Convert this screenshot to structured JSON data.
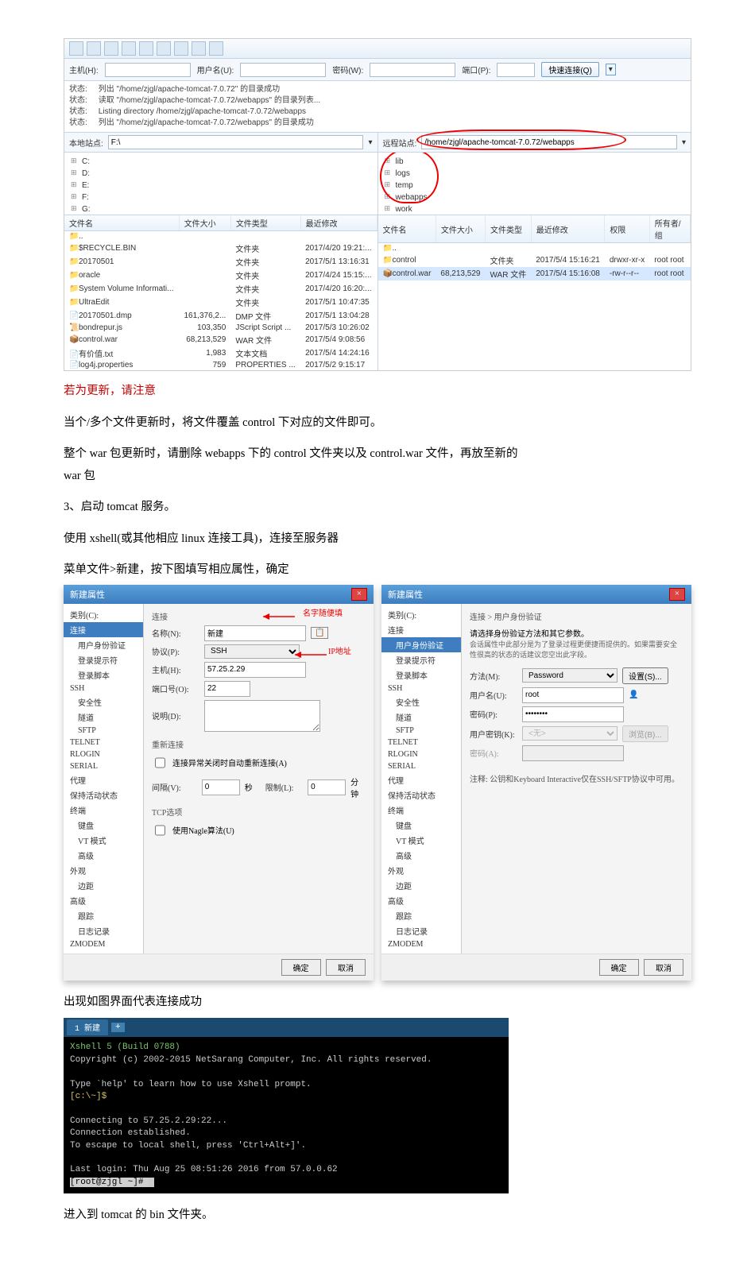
{
  "ftp": {
    "conn": {
      "host_label": "主机(H):",
      "user_label": "用户名(U):",
      "pass_label": "密码(W):",
      "port_label": "端口(P):",
      "connect_btn": "快速连接(Q)"
    },
    "status": [
      {
        "label": "状态:",
        "msg": "列出 \"/home/zjgl/apache-tomcat-7.0.72\" 的目录成功"
      },
      {
        "label": "状态:",
        "msg": "读取 \"/home/zjgl/apache-tomcat-7.0.72/webapps\" 的目录列表..."
      },
      {
        "label": "状态:",
        "msg": "Listing directory /home/zjgl/apache-tomcat-7.0.72/webapps"
      },
      {
        "label": "状态:",
        "msg": "列出 \"/home/zjgl/apache-tomcat-7.0.72/webapps\" 的目录成功"
      }
    ],
    "local": {
      "path_label": "本地站点:",
      "path": "F:\\",
      "tree": [
        "C:",
        "D:",
        "E:",
        "F:",
        "G:"
      ],
      "cols": [
        "文件名",
        "文件大小",
        "文件类型",
        "最近修改"
      ],
      "rows": [
        {
          "ic": "📁",
          "name": "..",
          "size": "",
          "type": "",
          "mtime": ""
        },
        {
          "ic": "📁",
          "name": "$RECYCLE.BIN",
          "size": "",
          "type": "文件夹",
          "mtime": "2017/4/20 19:21:..."
        },
        {
          "ic": "📁",
          "name": "20170501",
          "size": "",
          "type": "文件夹",
          "mtime": "2017/5/1 13:16:31"
        },
        {
          "ic": "📁",
          "name": "oracle",
          "size": "",
          "type": "文件夹",
          "mtime": "2017/4/24 15:15:..."
        },
        {
          "ic": "📁",
          "name": "System Volume Informati...",
          "size": "",
          "type": "文件夹",
          "mtime": "2017/4/20 16:20:..."
        },
        {
          "ic": "📁",
          "name": "UltraEdit",
          "size": "",
          "type": "文件夹",
          "mtime": "2017/5/1 10:47:35"
        },
        {
          "ic": "📄",
          "name": "20170501.dmp",
          "size": "161,376,2...",
          "type": "DMP 文件",
          "mtime": "2017/5/1 13:04:28"
        },
        {
          "ic": "📜",
          "name": "bondrepur.js",
          "size": "103,350",
          "type": "JScript Script ...",
          "mtime": "2017/5/3 10:26:02"
        },
        {
          "ic": "📦",
          "name": "control.war",
          "size": "68,213,529",
          "type": "WAR 文件",
          "mtime": "2017/5/4 9:08:56"
        },
        {
          "ic": "📄",
          "name": "有价值.txt",
          "size": "1,983",
          "type": "文本文档",
          "mtime": "2017/5/4 14:24:16"
        },
        {
          "ic": "📄",
          "name": "log4j.properties",
          "size": "759",
          "type": "PROPERTIES ...",
          "mtime": "2017/5/2 9:15:17"
        }
      ]
    },
    "remote": {
      "path_label": "远程站点:",
      "path": "/home/zjgl/apache-tomcat-7.0.72/webapps",
      "tree": [
        "lib",
        "logs",
        "temp",
        "webapps",
        "work"
      ],
      "cols": [
        "文件名",
        "文件大小",
        "文件类型",
        "最近修改",
        "权限",
        "所有者/组"
      ],
      "rows": [
        {
          "ic": "📁",
          "name": "..",
          "size": "",
          "type": "",
          "mtime": "",
          "perm": "",
          "owner": ""
        },
        {
          "ic": "📁",
          "name": "control",
          "size": "",
          "type": "文件夹",
          "mtime": "2017/5/4 15:16:21",
          "perm": "drwxr-xr-x",
          "owner": "root root"
        },
        {
          "ic": "📦",
          "name": "control.war",
          "size": "68,213,529",
          "type": "WAR 文件",
          "mtime": "2017/5/4 15:16:08",
          "perm": "-rw-r--r--",
          "owner": "root root"
        }
      ]
    }
  },
  "doc": {
    "warn": "若为更新，请注意",
    "p1": "当个/多个文件更新时，将文件覆盖 control 下对应的文件即可。",
    "p2a": "整个 war 包更新时，请删除 webapps 下的 control 文件夹以及 control.war 文件，再放至新的",
    "p2b": "war 包",
    "p3": "3、启动 tomcat 服务。",
    "p4": "使用 xshell(或其他相应 linux 连接工具)，连接至服务器",
    "p5": "菜单文件>新建，按下图填写相应属性，确定",
    "p6": "出现如图界面代表连接成功",
    "p7": "进入到 tomcat 的 bin 文件夹。"
  },
  "dlg1": {
    "title": "新建属性",
    "nav_cat": "类别(C):",
    "nav": [
      "连接",
      "用户身份验证",
      "登录提示符",
      "登录脚本",
      "SSH",
      "安全性",
      "隧道",
      "SFTP",
      "TELNET",
      "RLOGIN",
      "SERIAL",
      "代理",
      "保持活动状态",
      "终端",
      "键盘",
      "VT 模式",
      "高级",
      "外观",
      "边距",
      "高级",
      "跟踪",
      "日志记录",
      "ZMODEM"
    ],
    "sec1": "连接",
    "name_label": "名称(N):",
    "name_val": "新建",
    "proto_label": "协议(P):",
    "proto_val": "SSH",
    "host_label": "主机(H):",
    "host_val": "57.25.2.29",
    "port_label": "端口号(O):",
    "port_val": "22",
    "desc_label": "说明(D):",
    "sec2": "重新连接",
    "chk": "连接异常关闭时自动重新连接(A)",
    "int_label": "间隔(V):",
    "int_unit": "秒",
    "limit_label": "限制(L):",
    "limit_val": "0",
    "limit_unit": "分钟",
    "sec3": "TCP选项",
    "chk2": "使用Nagle算法(U)",
    "ok": "确定",
    "cancel": "取消",
    "arrow1": "名字随便填",
    "arrow2": "IP地址"
  },
  "dlg2": {
    "title": "新建属性",
    "crumb": "连接 > 用户身份验证",
    "desc1": "请选择身份验证方法和其它参数。",
    "desc2": "会话属性中此部分是为了登录过程更便捷而提供的。如果需要安全性很高的状态的话建议您空出此字段。",
    "method_label": "方法(M):",
    "method_val": "Password",
    "setup": "设置(S)...",
    "user_label": "用户名(U):",
    "user_val": "root",
    "pass_label": "密码(P):",
    "pass_val": "********",
    "key_label": "用户密钥(K):",
    "key_val": "<无>",
    "browse": "浏览(B)...",
    "pw2_label": "密码(A):",
    "note": "注释: 公钥和Keyboard Interactive仅在SSH/SFTP协议中可用。",
    "ok": "确定",
    "cancel": "取消"
  },
  "term": {
    "tab": "1 新建",
    "line1": "Xshell 5 (Build 0788)",
    "line2": "Copyright (c) 2002-2015 NetSarang Computer, Inc. All rights reserved.",
    "line3": "Type `help' to learn how to use Xshell prompt.",
    "prompt1": "[c:\\~]$",
    "line4": "Connecting to 57.25.2.29:22...",
    "line5": "Connection established.",
    "line6": "To escape to local shell, press 'Ctrl+Alt+]'.",
    "line7": "Last login: Thu Aug 25 08:51:26 2016 from 57.0.0.62",
    "prompt2": "[root@zjgl ~]# "
  }
}
